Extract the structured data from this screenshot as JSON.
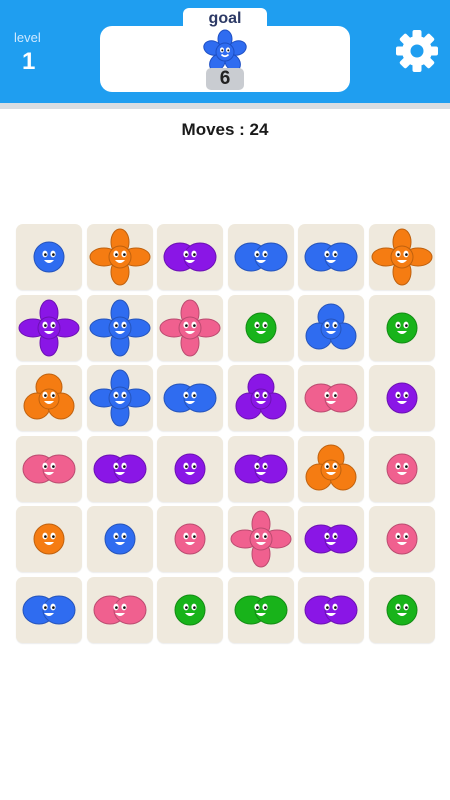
{
  "header": {
    "level_label": "level",
    "level_value": "1",
    "goal_label": "goal",
    "goal_icon": "blue-five-petal-flower-icon",
    "goal_count": "6",
    "settings_icon": "gear-icon"
  },
  "moves": {
    "label": "Moves : 24"
  },
  "colors": {
    "blue": "#2f6cf0",
    "orange": "#f57c12",
    "purple": "#8a16e6",
    "pink": "#f0608f",
    "green": "#18b31a",
    "header": "#1f9ef0"
  },
  "board": {
    "rows": 6,
    "cols": 6,
    "tiles": [
      [
        {
          "color": "blue",
          "shape": "circle"
        },
        {
          "color": "orange",
          "shape": "four-petal"
        },
        {
          "color": "purple",
          "shape": "double"
        },
        {
          "color": "blue",
          "shape": "double"
        },
        {
          "color": "blue",
          "shape": "double"
        },
        {
          "color": "orange",
          "shape": "four-petal"
        }
      ],
      [
        {
          "color": "purple",
          "shape": "four-petal"
        },
        {
          "color": "blue",
          "shape": "four-petal"
        },
        {
          "color": "pink",
          "shape": "four-petal"
        },
        {
          "color": "green",
          "shape": "circle"
        },
        {
          "color": "blue",
          "shape": "triple"
        },
        {
          "color": "green",
          "shape": "circle"
        }
      ],
      [
        {
          "color": "orange",
          "shape": "triple"
        },
        {
          "color": "blue",
          "shape": "four-petal"
        },
        {
          "color": "blue",
          "shape": "double"
        },
        {
          "color": "purple",
          "shape": "triple"
        },
        {
          "color": "pink",
          "shape": "double"
        },
        {
          "color": "purple",
          "shape": "circle"
        }
      ],
      [
        {
          "color": "pink",
          "shape": "double"
        },
        {
          "color": "purple",
          "shape": "double"
        },
        {
          "color": "purple",
          "shape": "circle"
        },
        {
          "color": "purple",
          "shape": "double"
        },
        {
          "color": "orange",
          "shape": "triple"
        },
        {
          "color": "pink",
          "shape": "circle"
        }
      ],
      [
        {
          "color": "orange",
          "shape": "circle"
        },
        {
          "color": "blue",
          "shape": "circle"
        },
        {
          "color": "pink",
          "shape": "circle"
        },
        {
          "color": "pink",
          "shape": "four-petal"
        },
        {
          "color": "purple",
          "shape": "double"
        },
        {
          "color": "pink",
          "shape": "circle"
        }
      ],
      [
        {
          "color": "blue",
          "shape": "double"
        },
        {
          "color": "pink",
          "shape": "double"
        },
        {
          "color": "green",
          "shape": "circle"
        },
        {
          "color": "green",
          "shape": "double"
        },
        {
          "color": "purple",
          "shape": "double"
        },
        {
          "color": "green",
          "shape": "circle"
        }
      ]
    ]
  }
}
